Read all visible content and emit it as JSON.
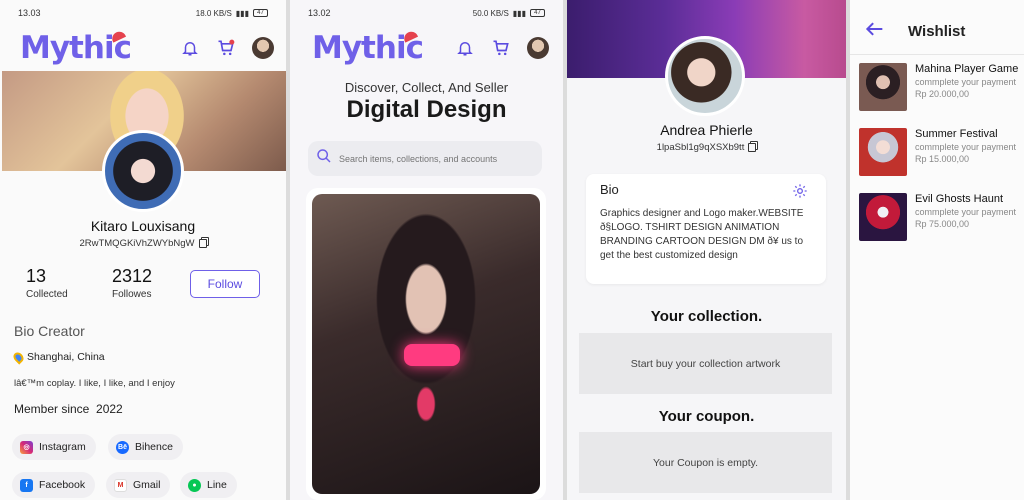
{
  "status1": {
    "time": "13.03",
    "battery": "47"
  },
  "status2": {
    "time": "13.02",
    "battery": "47"
  },
  "status_net": "18.0 KB/S",
  "status_net2": "50.0 KB/S",
  "brand": "Mythic",
  "profile": {
    "name": "Kitaro Louxisang",
    "address": "2RwTMQGKiVhZWYbNgW",
    "collected_count": "13",
    "collected_label": "Collected",
    "followes_count": "2312",
    "followes_label": "Followes",
    "follow_label": "Follow",
    "bio_title": "Bio Creator",
    "location": "Shanghai, China",
    "bio": "lâ€™m coplay. I like, I like, and I enjoy",
    "member_label": "Member since",
    "member_year": "2022",
    "socials": [
      "Instagram",
      "Bihence",
      "Facebook",
      "Gmail",
      "Line"
    ]
  },
  "home": {
    "tagline": "Discover, Collect, And Seller",
    "headline": "Digital Design",
    "search_placeholder": "Search items, collections, and accounts"
  },
  "user": {
    "name": "Andrea Phierle",
    "address": "1lpaSbl1g9qXSXb9tt",
    "bio_label": "Bio",
    "bio": "Graphics designer and Logo maker.WEBSITE ð§LOGO. TSHIRT DESIGN ANIMATION BRANDING CARTOON DESIGN DM ð¥ us to get the best customized design",
    "collection_title": "Your collection.",
    "collection_empty": "Start buy your collection artwork",
    "coupon_title": "Your coupon.",
    "coupon_empty": "Your Coupon is empty."
  },
  "wishlist": {
    "title": "Wishlist",
    "items": [
      {
        "title": "Mahina Player Game",
        "subtitle": "commplete your payment",
        "price": "Rp 20.000,00"
      },
      {
        "title": "Summer Festival",
        "subtitle": "commplete your payment",
        "price": "Rp 15.000,00"
      },
      {
        "title": "Evil Ghosts Haunt",
        "subtitle": "commplete your payment",
        "price": "Rp 75.000,00"
      }
    ]
  },
  "colors": {
    "accent": "#6f60e8",
    "logo_accent": "#e5424d"
  }
}
